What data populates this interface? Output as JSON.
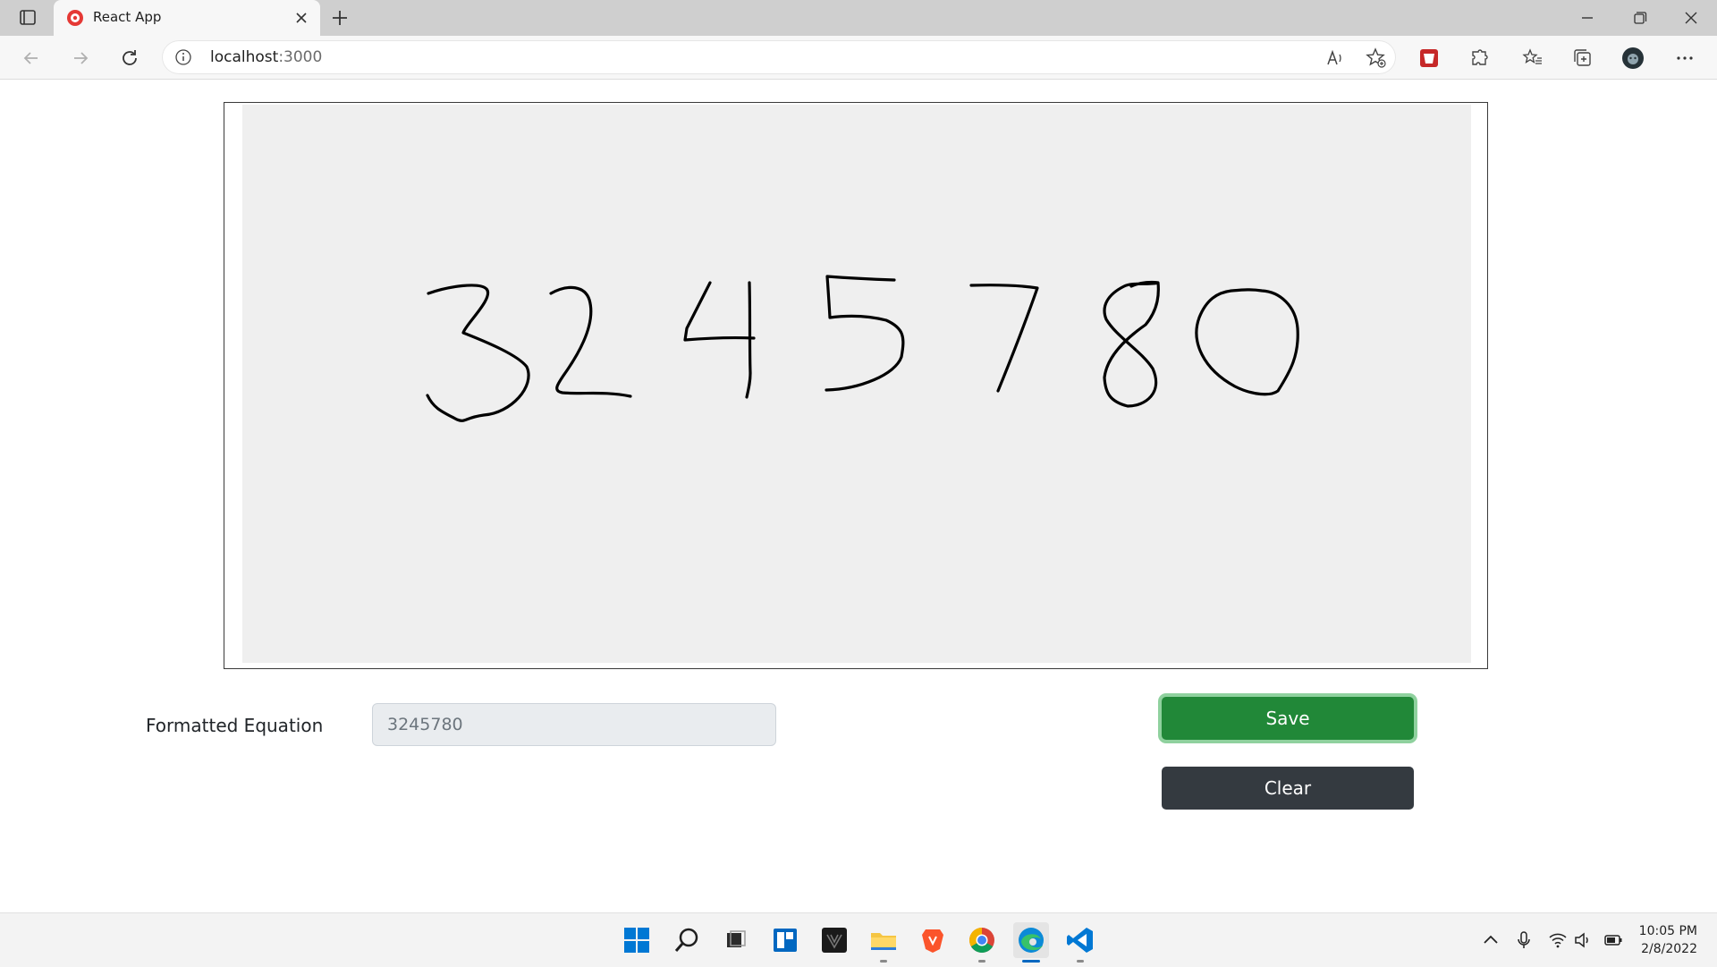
{
  "browser": {
    "tab_title": "React App",
    "url_host": "localhost",
    "url_port": ":3000"
  },
  "page": {
    "canvas_drawing": "3245780",
    "equation_label": "Formatted Equation",
    "equation_value": "3245780",
    "save_label": "Save",
    "clear_label": "Clear"
  },
  "taskbar": {
    "apps": [
      "start-icon",
      "search-icon",
      "task-view-icon",
      "widgets-icon",
      "predator-app-icon",
      "file-explorer-icon",
      "brave-icon",
      "chrome-icon",
      "edge-icon",
      "vscode-icon"
    ],
    "time": "10:05 PM",
    "date": "2/8/2022"
  },
  "colors": {
    "save": "#218838",
    "clear": "#343a40",
    "canvas_bg": "#efefef"
  }
}
